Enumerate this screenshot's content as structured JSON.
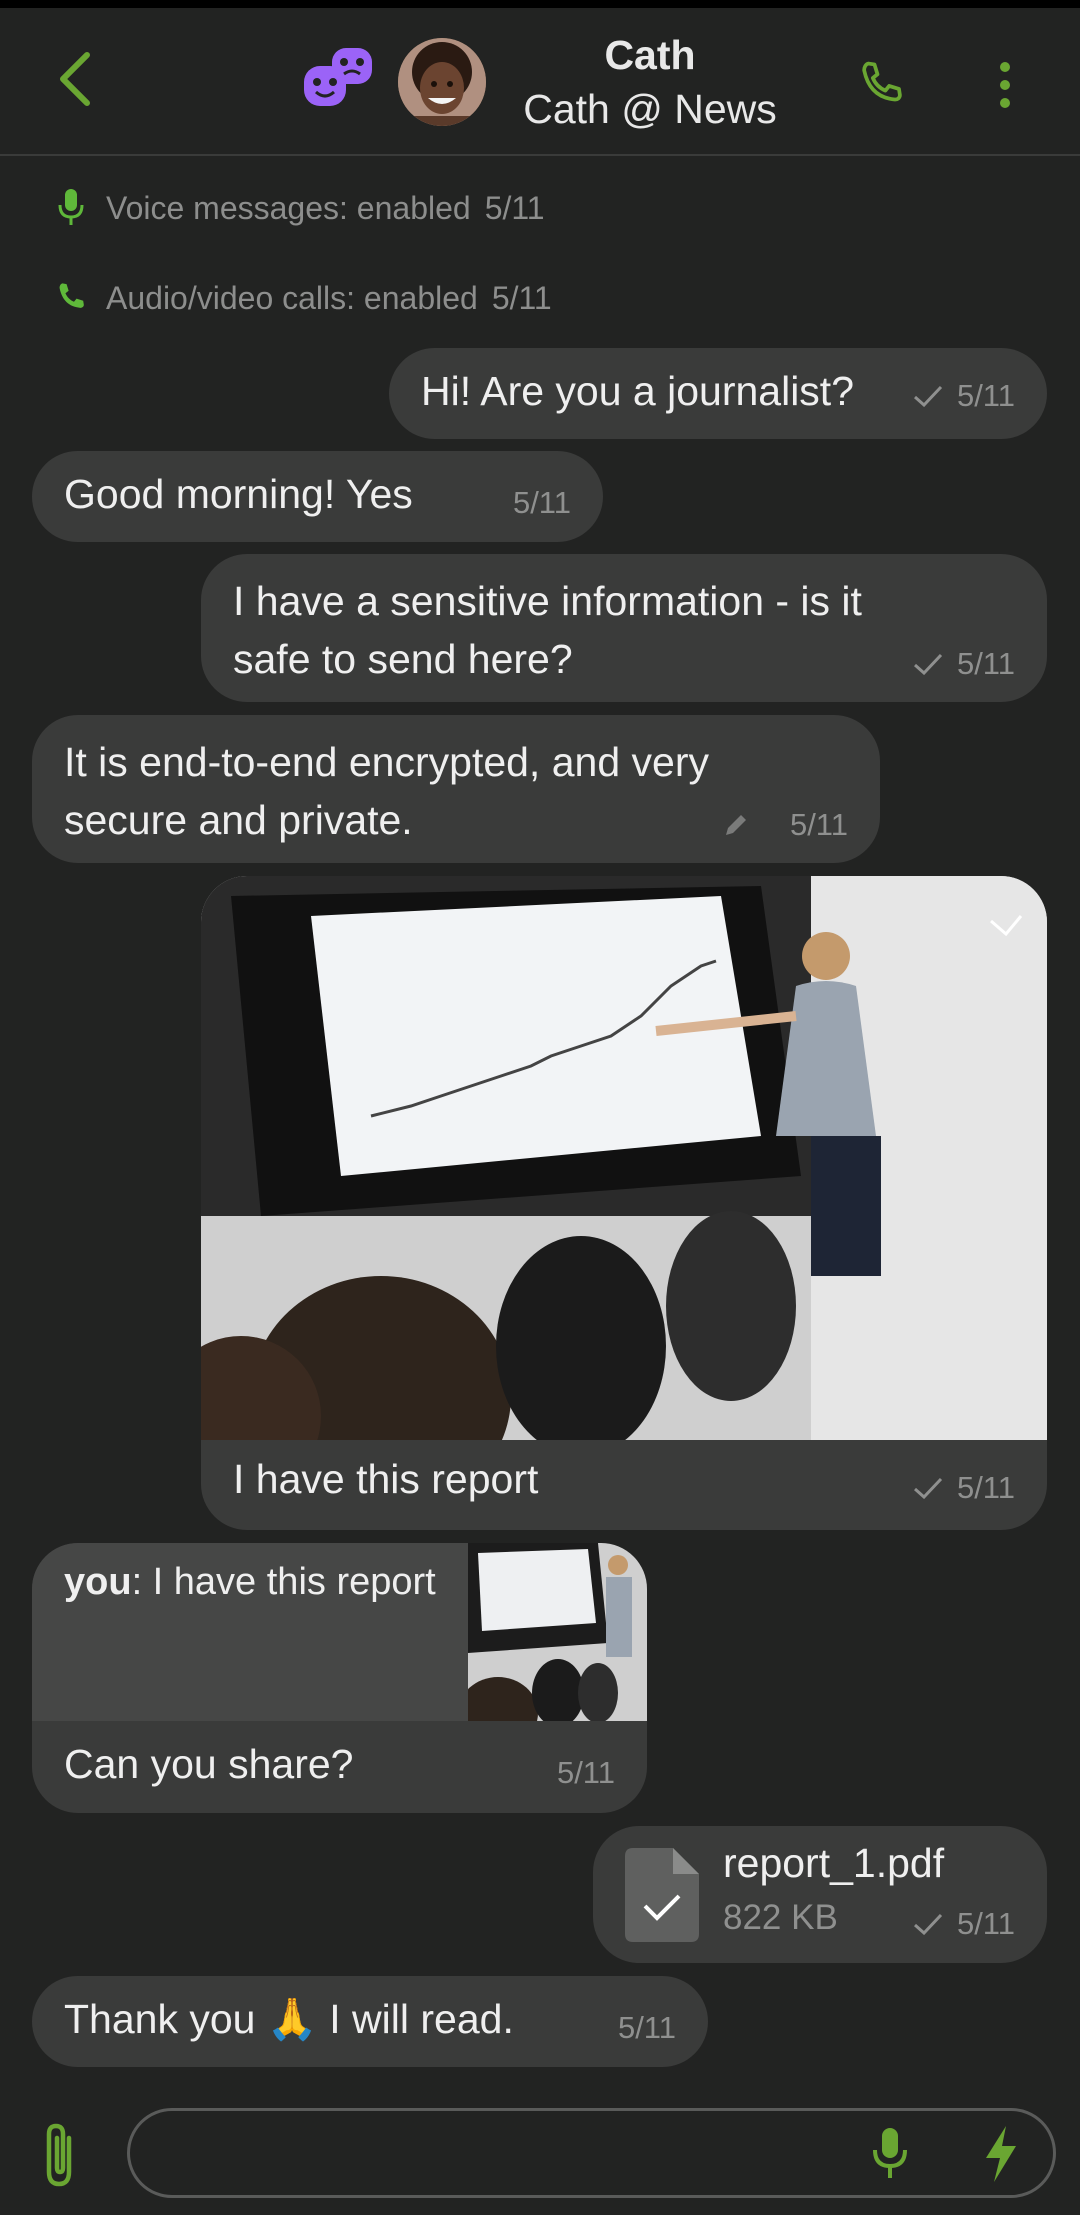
{
  "header": {
    "title": "Cath",
    "subtitle": "Cath @ News",
    "colors": {
      "accent": "#6aa632",
      "incognito": "#9b63f7"
    }
  },
  "events": [
    {
      "label": "Voice messages: enabled",
      "time": "5/11",
      "icon": "microphone-icon"
    },
    {
      "label": "Audio/video calls: enabled",
      "time": "5/11",
      "icon": "phone-icon"
    }
  ],
  "messages": [
    {
      "text": "Hi! Are you a journalist?",
      "time": "5/11"
    },
    {
      "text": "Good morning! Yes",
      "time": "5/11"
    },
    {
      "text_line1": "I have a sensitive information - is it",
      "text_line2": "safe to send here?",
      "time": "5/11"
    },
    {
      "text_line1": "It is end-to-end encrypted, and very",
      "text_line2": "secure and private.",
      "time": "5/11"
    },
    {
      "caption": "I have this report",
      "time": "5/11"
    },
    {
      "quote_author": "you",
      "quote_text": ": I have this report",
      "text": "Can you share?",
      "time": "5/11"
    },
    {
      "file_name": "report_1.pdf",
      "file_size": "822 KB",
      "time": "5/11"
    },
    {
      "text": "Thank you 🙏 I will read.",
      "time": "5/11"
    }
  ],
  "composer": {
    "placeholder": ""
  }
}
